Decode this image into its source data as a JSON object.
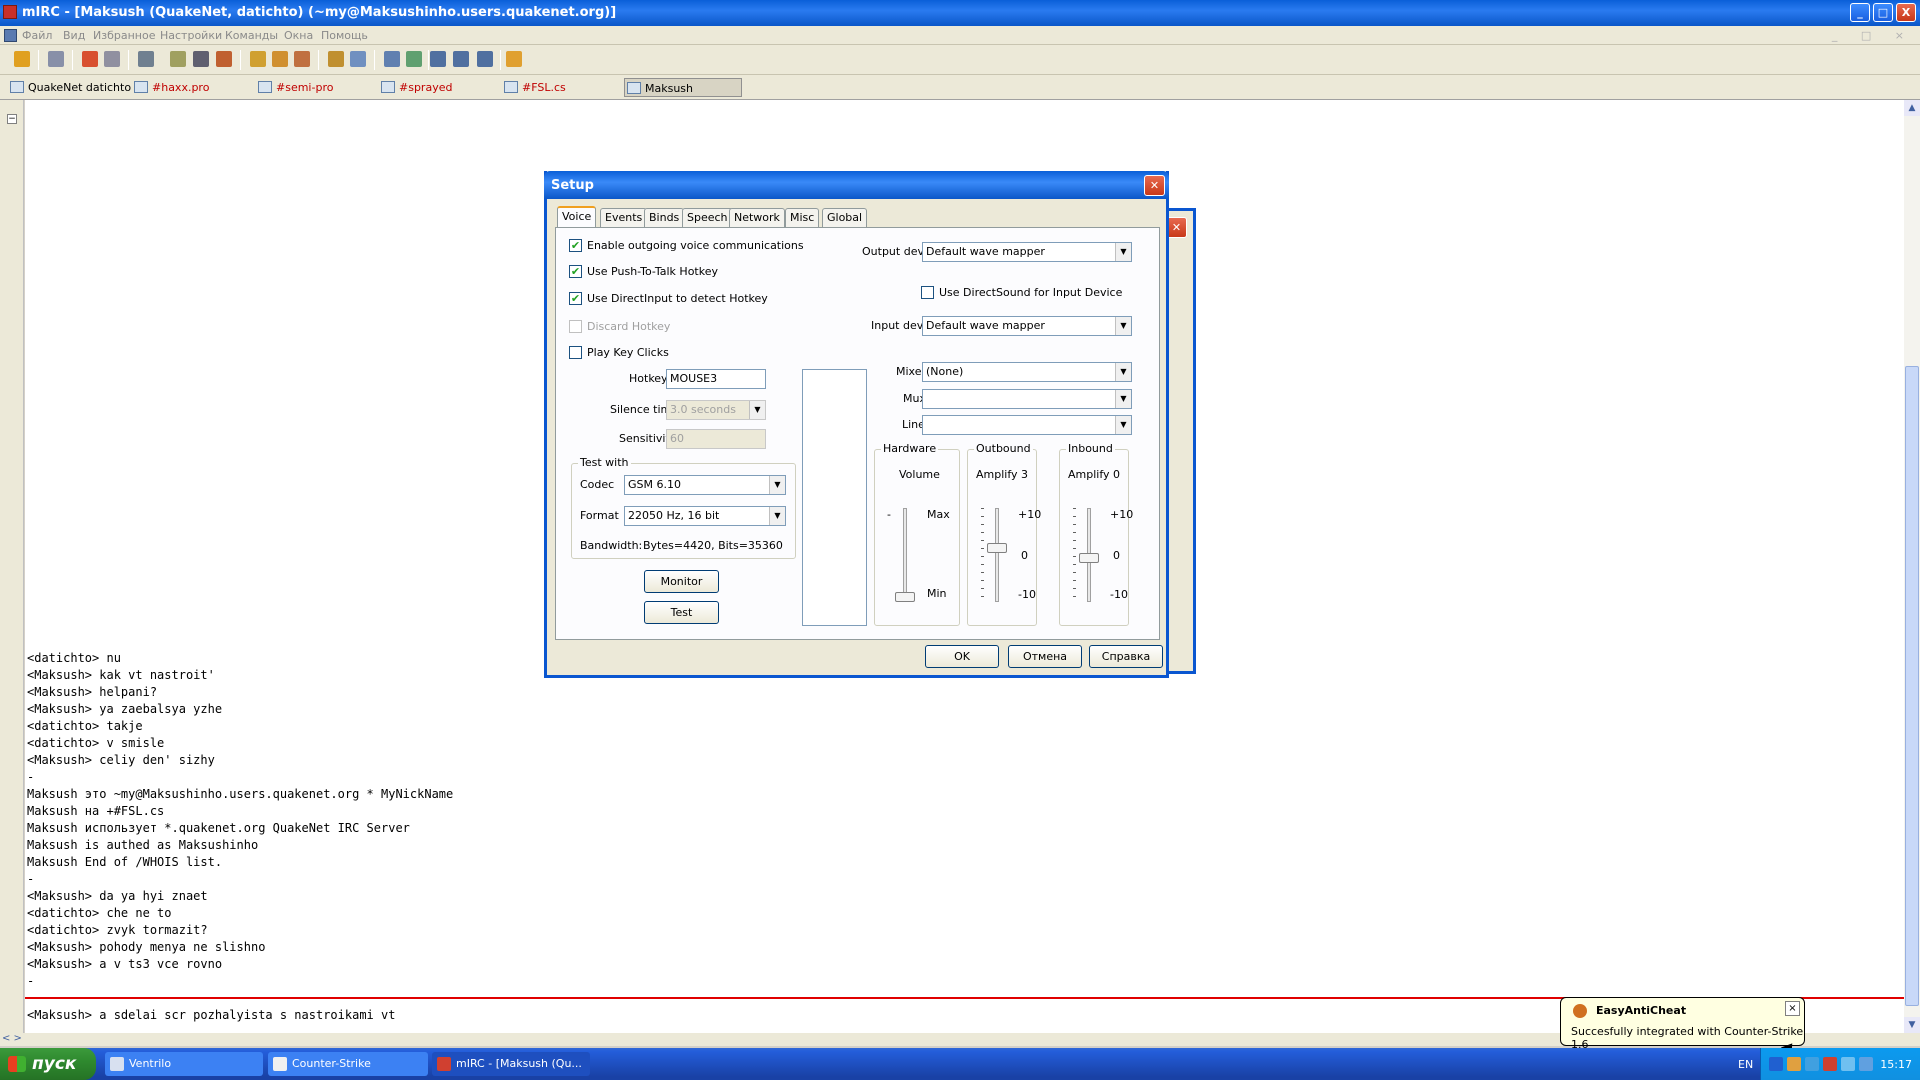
{
  "window": {
    "title": "mIRC - [Maksush (QuakeNet, datichto) (~my@Maksushinho.users.quakenet.org)]",
    "buttons": [
      "_",
      "□",
      "X"
    ]
  },
  "menu": {
    "items": [
      "Файл",
      "Вид",
      "Избранное",
      "Настройки",
      "Команды",
      "Окна",
      "Помощь"
    ],
    "mdi_buttons": "_ □ ×"
  },
  "switchbar": {
    "items": [
      {
        "label": "QuakeNet datichto",
        "color": "#000000"
      },
      {
        "label": "#haxx.pro",
        "color": "#c00000"
      },
      {
        "label": "#semi-pro",
        "color": "#c00000"
      },
      {
        "label": "#sprayed",
        "color": "#c00000"
      },
      {
        "label": "#FSL.cs",
        "color": "#c00000"
      },
      {
        "label": "Maksush",
        "color": "#000000"
      }
    ]
  },
  "chat": {
    "lines": [
      "<datichto> nu",
      "<Maksush> kak vt nastroit'",
      "<Maksush> helpani?",
      "<Maksush> ya zaebalsya yzhe",
      "<datichto> takje",
      "<datichto> v smisle",
      "<Maksush> celiy den' sizhy",
      "-",
      "Maksush это ~my@Maksushinho.users.quakenet.org * MyNickName",
      "Maksush на +#FSL.cs",
      "Maksush использует *.quakenet.org QuakeNet IRC Server",
      "Maksush is authed as Maksushinho",
      "Maksush End of /WHOIS list.",
      "-",
      "<Maksush> da ya hyi znaet",
      "<datichto> che ne to",
      "<datichto> zvyk tormazit?",
      "<Maksush> pohody menya ne slishno",
      "<Maksush> a v ts3 vce rovno",
      "-"
    ],
    "input_value": "<Maksush> a sdelai scr pozhalyista s nastroikami vt"
  },
  "setup": {
    "title": "Setup",
    "tabs": [
      "Voice",
      "Events",
      "Binds",
      "Speech",
      "Network",
      "Misc",
      "Global"
    ],
    "active_tab": "Voice",
    "checks": {
      "enable_outgoing": {
        "label": "Enable outgoing voice communications",
        "checked": true
      },
      "push_to_talk": {
        "label": "Use Push-To-Talk Hotkey",
        "checked": true
      },
      "directinput": {
        "label": "Use DirectInput to detect Hotkey",
        "checked": true
      },
      "discard": {
        "label": "Discard Hotkey",
        "checked": false
      },
      "key_clicks": {
        "label": "Play Key Clicks",
        "checked": false
      },
      "directsound": {
        "label": "Use DirectSound for Input Device",
        "checked": false
      }
    },
    "hotkey": {
      "label": "Hotkey",
      "value": "MOUSE3"
    },
    "silence": {
      "label": "Silence time",
      "value": "3.0 seconds"
    },
    "sensitivity": {
      "label": "Sensitivity",
      "value": "60"
    },
    "test_with": {
      "label": "Test with",
      "codec_label": "Codec",
      "codec_value": "GSM 6.10",
      "format_label": "Format",
      "format_value": "22050 Hz, 16 bit",
      "bandwidth_label": "Bandwidth:",
      "bandwidth_value": "Bytes=4420, Bits=35360"
    },
    "monitor_label": "Monitor",
    "test_label": "Test",
    "output_device": {
      "label": "Output device",
      "value": "Default wave mapper"
    },
    "input_device": {
      "label": "Input device",
      "value": "Default wave mapper"
    },
    "mixer": {
      "label": "Mixer",
      "value": "(None)"
    },
    "mux": {
      "label": "Mux",
      "value": ""
    },
    "line": {
      "label": "Line",
      "value": ""
    },
    "hardware": {
      "label": "Hardware",
      "volume_label": "Volume",
      "minus": "-",
      "max_label": "Max",
      "min_label": "Min"
    },
    "outbound": {
      "label": "Outbound",
      "amplify_label": "Amplify",
      "amplify_value": "3",
      "plus": "+10",
      "zero": "0",
      "minus": "-10"
    },
    "inbound": {
      "label": "Inbound",
      "amplify_label": "Amplify",
      "amplify_value": "0",
      "plus": "+10",
      "zero": "0",
      "minus": "-10"
    },
    "ok_label": "OK",
    "cancel_label": "Отмена",
    "help_label": "Справка"
  },
  "taskbar": {
    "start_label": "пуск",
    "tasks": [
      "Ventrilo",
      "Counter-Strike",
      "mIRC - [Maksush (Qu..."
    ],
    "language": "EN",
    "clock": "15:17"
  },
  "balloon": {
    "title": "EasyAntiCheat",
    "text": "Succesfully integrated with Counter-Strike 1.6",
    "close": "×"
  },
  "colors": {
    "title_blue": "#0a5fd8",
    "channel_red": "#c00000",
    "separator_red": "#e00000"
  }
}
